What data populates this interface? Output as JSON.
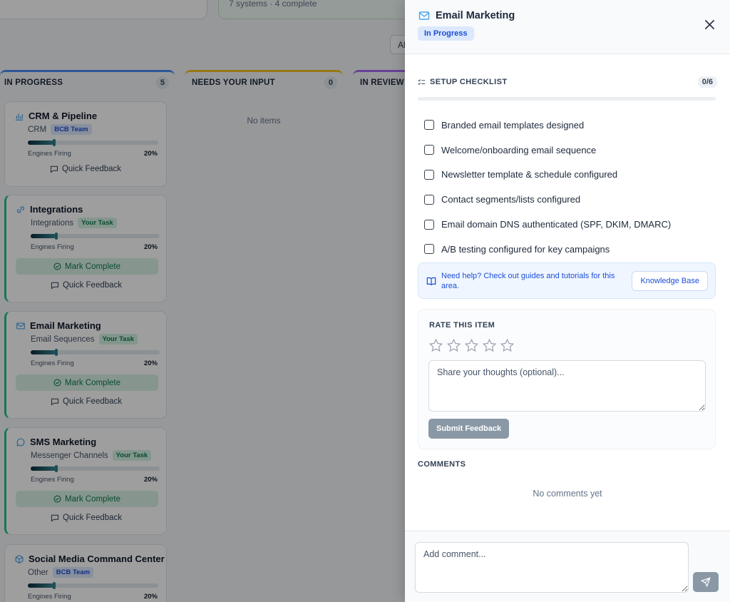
{
  "board": {
    "top_cards": [
      {
        "sub": ""
      },
      {
        "sub": "7 systems · 4 complete"
      }
    ],
    "filter_button": "Al",
    "columns": [
      {
        "title": "IN PROGRESS",
        "count": "5"
      },
      {
        "title": "NEEDS YOUR INPUT",
        "count": "0"
      },
      {
        "title": "IN REVIEW",
        "count": ""
      }
    ],
    "empty_text": "No items",
    "cards": [
      {
        "title": "CRM & Pipeline",
        "icon": "bar-chart-icon",
        "category": "CRM",
        "badge": "BCB Team",
        "badge_type": "team",
        "progress_label": "Engines Firing",
        "progress_pct": "20%",
        "progress": 0.2,
        "mark_complete": "",
        "quick_feedback": "Quick Feedback"
      },
      {
        "title": "Integrations",
        "icon": "link-icon",
        "category": "Integrations",
        "badge": "Your Task",
        "badge_type": "task",
        "progress_label": "Engines Firing",
        "progress_pct": "20%",
        "progress": 0.2,
        "mark_complete": "Mark Complete",
        "quick_feedback": "Quick Feedback"
      },
      {
        "title": "Email Marketing",
        "icon": "mail-icon",
        "category": "Email Sequences",
        "badge": "Your Task",
        "badge_type": "task",
        "progress_label": "Engines Firing",
        "progress_pct": "20%",
        "progress": 0.2,
        "mark_complete": "Mark Complete",
        "quick_feedback": "Quick Feedback"
      },
      {
        "title": "SMS Marketing",
        "icon": "message-icon",
        "category": "Messenger Channels",
        "badge": "Your Task",
        "badge_type": "task",
        "progress_label": "Engines Firing",
        "progress_pct": "20%",
        "progress": 0.2,
        "mark_complete": "Mark Complete",
        "quick_feedback": "Quick Feedback"
      },
      {
        "title": "Social Media Command Center",
        "icon": "box-icon",
        "category": "Other",
        "badge": "BCB Team",
        "badge_type": "team",
        "progress_label": "Engines Firing",
        "progress_pct": "20%",
        "progress": 0.2,
        "mark_complete": "",
        "quick_feedback": ""
      }
    ]
  },
  "drawer": {
    "title": "Email Marketing",
    "status": "In Progress",
    "checklist": {
      "title": "SETUP CHECKLIST",
      "count": "0/6",
      "progress": 0,
      "items": [
        {
          "label": "Branded email templates designed",
          "checked": false
        },
        {
          "label": "Welcome/onboarding email sequence",
          "checked": false
        },
        {
          "label": "Newsletter template & schedule configured",
          "checked": false
        },
        {
          "label": "Contact segments/lists configured",
          "checked": false
        },
        {
          "label": "Email domain DNS authenticated (SPF, DKIM, DMARC)",
          "checked": false
        },
        {
          "label": "A/B testing configured for key campaigns",
          "checked": false
        }
      ]
    },
    "help": {
      "text": "Need help? Check out guides and tutorials for this area.",
      "button": "Knowledge Base"
    },
    "rating": {
      "title": "RATE THIS ITEM",
      "stars": 0,
      "max_stars": 5,
      "placeholder": "Share your thoughts (optional)...",
      "submit": "Submit Feedback"
    },
    "comments": {
      "title": "COMMENTS",
      "empty": "No comments yet",
      "placeholder": "Add comment..."
    }
  },
  "colors": {
    "accent_blue": "#1d4ed8",
    "task_green": "#22c08a",
    "disabled_button": "#8a98a6"
  }
}
